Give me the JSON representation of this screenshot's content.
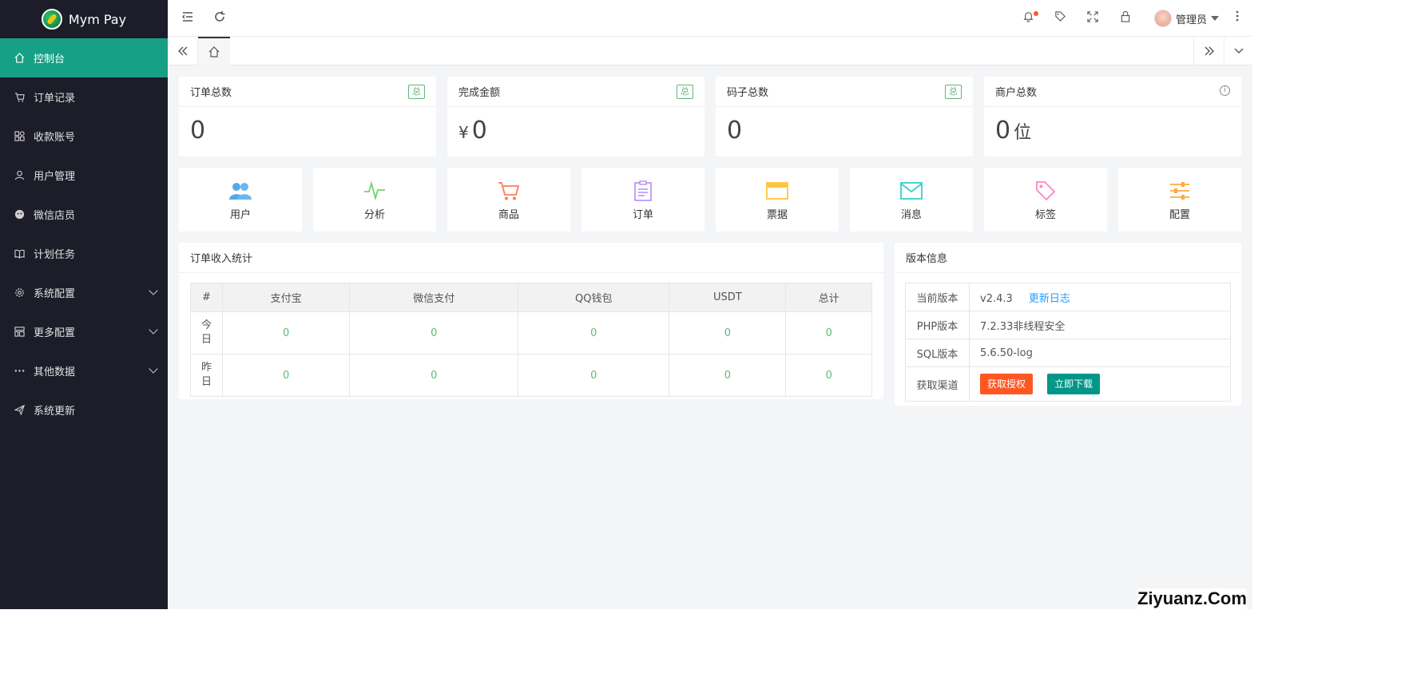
{
  "app": {
    "name": "Mym Pay"
  },
  "sidebar": {
    "items": [
      {
        "label": "控制台",
        "icon": "home-icon",
        "active": true
      },
      {
        "label": "订单记录",
        "icon": "cart-icon"
      },
      {
        "label": "收款账号",
        "icon": "apps-icon"
      },
      {
        "label": "用户管理",
        "icon": "user-icon"
      },
      {
        "label": "微信店员",
        "icon": "wechat-icon"
      },
      {
        "label": "计划任务",
        "icon": "book-icon"
      },
      {
        "label": "系统配置",
        "icon": "gear-icon",
        "expandable": true
      },
      {
        "label": "更多配置",
        "icon": "template-icon",
        "expandable": true
      },
      {
        "label": "其他数据",
        "icon": "more-icon",
        "expandable": true
      },
      {
        "label": "系统更新",
        "icon": "send-icon"
      }
    ]
  },
  "header": {
    "user_name": "管理员"
  },
  "stats": [
    {
      "title": "订单总数",
      "badge": "总",
      "value": "0",
      "prefix": "",
      "unit": ""
    },
    {
      "title": "完成金额",
      "badge": "总",
      "value": "0",
      "prefix": "¥",
      "unit": ""
    },
    {
      "title": "码子总数",
      "badge": "总",
      "value": "0",
      "prefix": "",
      "unit": ""
    },
    {
      "title": "商户总数",
      "badge": "",
      "value": "0",
      "prefix": "",
      "unit": "位"
    }
  ],
  "quick": [
    {
      "label": "用户",
      "icon": "users-icon",
      "color": "#53a8e8"
    },
    {
      "label": "分析",
      "icon": "pulse-icon",
      "color": "#6ed36e"
    },
    {
      "label": "商品",
      "icon": "cart-icon",
      "color": "#ff7a59"
    },
    {
      "label": "订单",
      "icon": "clipboard-icon",
      "color": "#b38df7"
    },
    {
      "label": "票据",
      "icon": "card-icon",
      "color": "#ffc53d"
    },
    {
      "label": "消息",
      "icon": "mail-icon",
      "color": "#36cfc9"
    },
    {
      "label": "标签",
      "icon": "tag-icon",
      "color": "#ff85c0"
    },
    {
      "label": "配置",
      "icon": "sliders-icon",
      "color": "#ffa940"
    }
  ],
  "orders": {
    "title": "订单收入统计",
    "columns": [
      "#",
      "支付宝",
      "微信支付",
      "QQ钱包",
      "USDT",
      "总计"
    ],
    "rows": [
      {
        "label": "今日",
        "values": [
          "0",
          "0",
          "0",
          "0",
          "0"
        ]
      },
      {
        "label": "昨日",
        "values": [
          "0",
          "0",
          "0",
          "0",
          "0"
        ]
      }
    ]
  },
  "version": {
    "title": "版本信息",
    "current_label": "当前版本",
    "current_value": "v2.4.3",
    "changelog_link": "更新日志",
    "php_label": "PHP版本",
    "php_value": "7.2.33非线程安全",
    "sql_label": "SQL版本",
    "sql_value": "5.6.50-log",
    "channel_label": "获取渠道",
    "auth_button": "获取授权",
    "download_button": "立即下载",
    "auth_color": "#ff5722",
    "download_color": "#009688"
  },
  "watermark": "Ziyuanz.Com"
}
